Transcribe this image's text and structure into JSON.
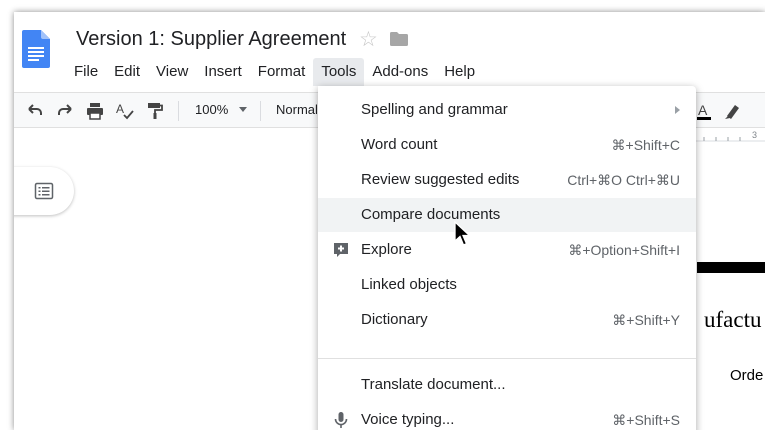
{
  "document": {
    "title": "Version 1: Supplier Agreement",
    "text_line_1": "ufactu",
    "text_line_2": "Orde"
  },
  "menubar": {
    "items": [
      "File",
      "Edit",
      "View",
      "Insert",
      "Format",
      "Tools",
      "Add-ons",
      "Help"
    ],
    "active": "Tools"
  },
  "toolbar": {
    "zoom": "100%",
    "style": "Normal"
  },
  "ruler": {
    "label": "3"
  },
  "tools_menu": {
    "items": [
      {
        "label": "Spelling and grammar",
        "shortcut": "",
        "submenu": true
      },
      {
        "label": "Word count",
        "shortcut": "⌘+Shift+C"
      },
      {
        "label": "Review suggested edits",
        "shortcut": "Ctrl+⌘O Ctrl+⌘U"
      },
      {
        "label": "Compare documents",
        "shortcut": "",
        "hovered": true
      },
      {
        "label": "Explore",
        "shortcut": "⌘+Option+Shift+I",
        "icon": "explore-plus-icon"
      },
      {
        "label": "Linked objects",
        "shortcut": ""
      },
      {
        "label": "Dictionary",
        "shortcut": "⌘+Shift+Y"
      },
      {
        "label": "Translate document...",
        "shortcut": ""
      },
      {
        "label": "Voice typing...",
        "shortcut": "⌘+Shift+S",
        "icon": "microphone-icon"
      }
    ]
  },
  "colors": {
    "docs_blue": "#4285f4",
    "menu_hover": "#f1f3f4",
    "active_menu": "#e8eaed"
  }
}
